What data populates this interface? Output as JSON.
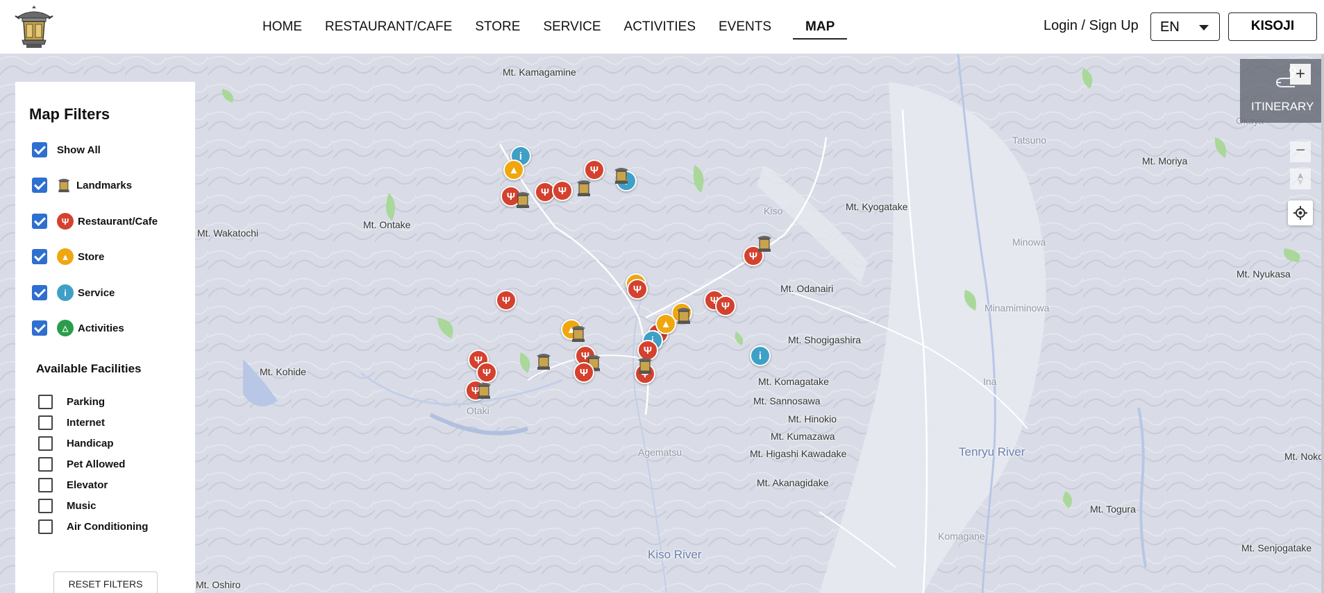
{
  "header": {
    "logo_icon": "lantern-logo-icon",
    "nav": [
      {
        "label": "HOME"
      },
      {
        "label": "RESTAURANT/CAFE"
      },
      {
        "label": "STORE"
      },
      {
        "label": "SERVICE"
      },
      {
        "label": "ACTIVITIES"
      },
      {
        "label": "EVENTS"
      },
      {
        "label": "MAP",
        "active": true
      }
    ],
    "login_label": "Login / Sign Up",
    "language": "EN",
    "brand_label": "KISOJI"
  },
  "filters": {
    "title": "Map Filters",
    "items": [
      {
        "label": "Show All",
        "checked": true,
        "icon": ""
      },
      {
        "label": "Landmarks",
        "checked": true,
        "icon": "lantern-icon"
      },
      {
        "label": "Restaurant/Cafe",
        "checked": true,
        "icon": "fork-knife-icon",
        "color": "#d4412e"
      },
      {
        "label": "Store",
        "checked": true,
        "icon": "shopping-bag-icon",
        "color": "#f0a70f"
      },
      {
        "label": "Service",
        "checked": true,
        "icon": "info-icon",
        "color": "#3fa0c7"
      },
      {
        "label": "Activities",
        "checked": true,
        "icon": "triangle-icon",
        "color": "#2a9d4a"
      }
    ]
  },
  "facilities": {
    "title": "Available Facilities",
    "items": [
      {
        "label": "Parking",
        "checked": false
      },
      {
        "label": "Internet",
        "checked": false
      },
      {
        "label": "Handicap",
        "checked": false
      },
      {
        "label": "Pet Allowed",
        "checked": false
      },
      {
        "label": "Elevator",
        "checked": false
      },
      {
        "label": "Music",
        "checked": false
      },
      {
        "label": "Air Conditioning",
        "checked": false
      }
    ],
    "reset_label": "RESET FILTERS"
  },
  "controls": {
    "itinerary_label": "ITINERARY",
    "zoom_in": "+",
    "zoom_out": "−"
  },
  "map": {
    "labels": {
      "kamagamine": "Mt. Kamagamine",
      "wakatochi": "Mt. Wakatochi",
      "ontake": "Mt. Ontake",
      "kohide": "Mt. Kohide",
      "oshiro": "Mt. Oshiro",
      "kyogatake": "Mt. Kyogatake",
      "odanairi": "Mt. Odanairi",
      "shogigashira": "Mt. Shogigashira",
      "komagatake": "Mt. Komagatake",
      "sannosawa": "Mt. Sannosawa",
      "hinokio": "Mt. Hinokio",
      "kumazawa": "Mt. Kumazawa",
      "higashi": "Mt. Higashi Kawadake",
      "akanagidake": "Mt. Akanagidake",
      "moriya": "Mt. Moriya",
      "nyukasa": "Mt. Nyukasa",
      "togura": "Mt. Togura",
      "senjogatake": "Mt. Senjogatake",
      "noko": "Mt. Noko",
      "tatsuno": "Tatsuno",
      "minowa": "Minowa",
      "minamiminowa": "Minamiminowa",
      "ina": "Ina",
      "komagane": "Komagane",
      "agematsu": "Agematsu",
      "otaki": "Otaki",
      "kiso": "Kiso",
      "okaya": "Okaya",
      "tenryu": "Tenryu River",
      "kiso_river": "Kiso River"
    }
  }
}
